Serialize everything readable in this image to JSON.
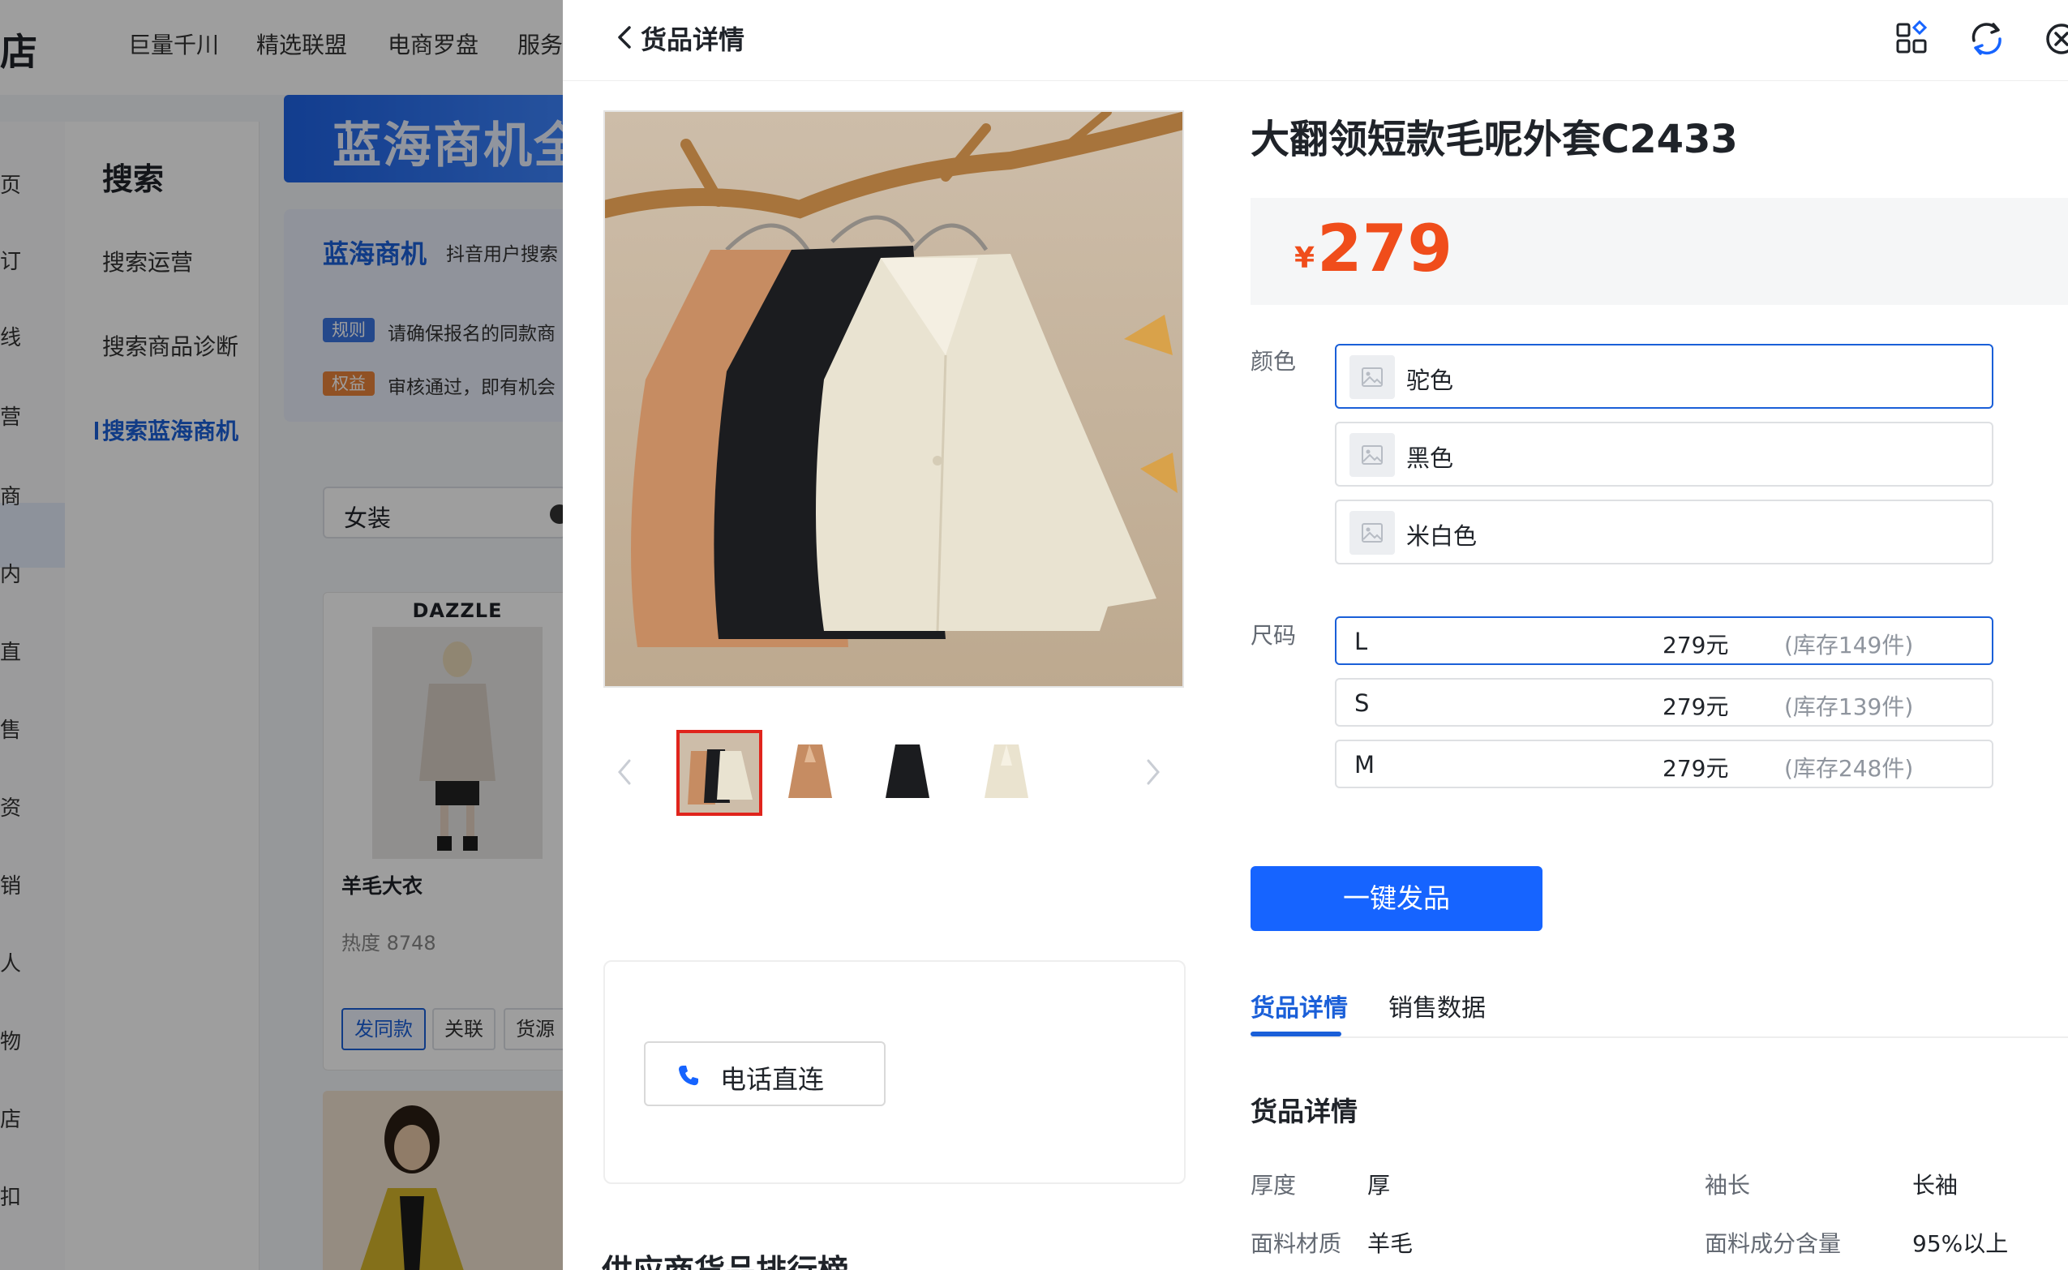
{
  "background": {
    "logo_fragment": "店",
    "nav": [
      "巨量千川",
      "精选联盟",
      "电商罗盘",
      "服务"
    ],
    "rail": [
      "页",
      "订",
      "线",
      "营",
      "商",
      "内",
      "直",
      "售",
      "资",
      "销",
      "人",
      "物",
      "店",
      "扣"
    ],
    "sidebar": {
      "title": "搜索",
      "items": [
        {
          "label": "搜索运营"
        },
        {
          "label": "搜索商品诊断"
        },
        {
          "label": "搜索蓝海商机"
        }
      ]
    },
    "banner_text": "蓝海商机全",
    "bluesea": {
      "title": "蓝海商机",
      "subtitle": "抖音用户搜索",
      "rule_tag": "规则",
      "rule_text": "请确保报名的同款商",
      "benefit_tag": "权益",
      "benefit_text": "审核通过，即有机会"
    },
    "search_value": "女装",
    "product": {
      "brand": "DAZZLE",
      "name": "羊毛大衣",
      "heat": "热度 8748",
      "buttons": [
        "发同款",
        "关联",
        "货源"
      ]
    }
  },
  "drawer": {
    "title": "货品详情",
    "header_icons": [
      "apps-icon",
      "refresh-icon",
      "close-icon"
    ],
    "product_title": "大翻领短款毛呢外套C2433",
    "currency": "¥",
    "price": "279",
    "color_label": "颜色",
    "colors": [
      {
        "name": "驼色",
        "selected": true
      },
      {
        "name": "黑色",
        "selected": false
      },
      {
        "name": "米白色",
        "selected": false
      }
    ],
    "size_label": "尺码",
    "sizes": [
      {
        "name": "L",
        "price": "279元",
        "stock": "(库存149件)",
        "selected": true
      },
      {
        "name": "S",
        "price": "279元",
        "stock": "(库存139件)",
        "selected": false
      },
      {
        "name": "M",
        "price": "279元",
        "stock": "(库存248件)",
        "selected": false
      }
    ],
    "publish_button": "一键发品",
    "tabs": [
      {
        "label": "货品详情",
        "active": true
      },
      {
        "label": "销售数据",
        "active": false
      }
    ],
    "section_title": "货品详情",
    "attributes": [
      {
        "key": "厚度",
        "value": "厚"
      },
      {
        "key": "袖长",
        "value": "长袖"
      },
      {
        "key": "面料材质",
        "value": "羊毛"
      },
      {
        "key": "面料成分含量",
        "value": "95%以上"
      }
    ],
    "phone_button": "电话直连",
    "ranking_title": "供应商货品排行榜",
    "colors_ui": {
      "accent": "#1664ff",
      "price": "#f04d1b",
      "thumb_selected": "#e0241c"
    }
  }
}
